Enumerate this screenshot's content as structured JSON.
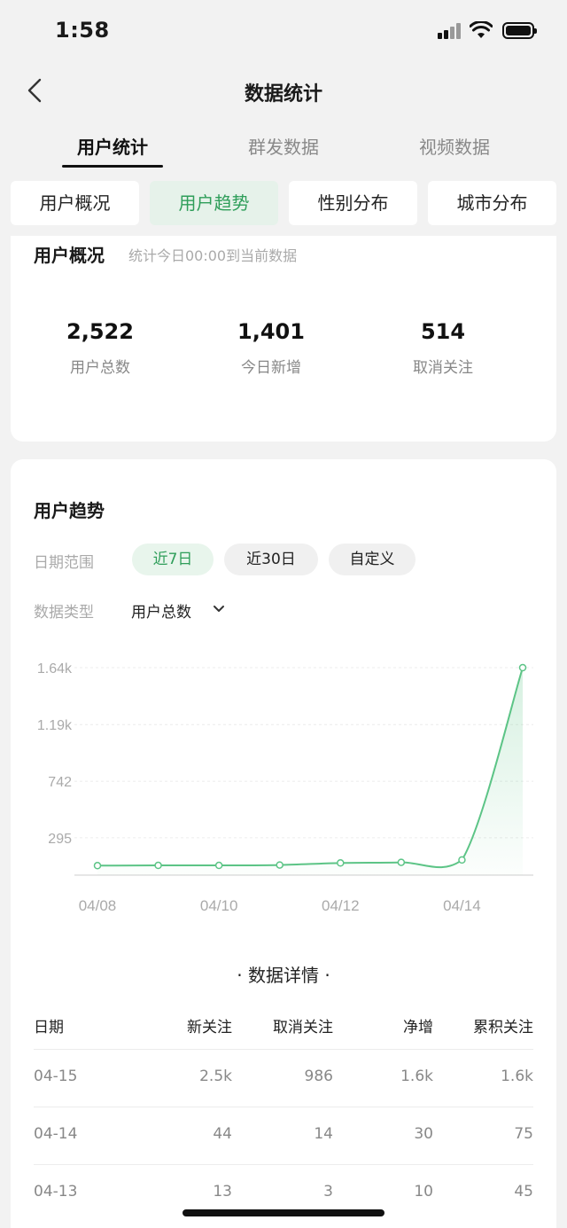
{
  "status_bar": {
    "time": "1:58"
  },
  "nav": {
    "title": "数据统计"
  },
  "tabs": [
    "用户统计",
    "群发数据",
    "视频数据"
  ],
  "subtabs": [
    "用户概况",
    "用户趋势",
    "性别分布",
    "城市分布"
  ],
  "overview": {
    "title": "用户概况",
    "subtitle": "统计今日00:00到当前数据",
    "stats": [
      {
        "value": "2,522",
        "label": "用户总数"
      },
      {
        "value": "1,401",
        "label": "今日新增"
      },
      {
        "value": "514",
        "label": "取消关注"
      }
    ]
  },
  "trend": {
    "title": "用户趋势",
    "date_range_label": "日期范围",
    "date_options": [
      "近7日",
      "近30日",
      "自定义"
    ],
    "type_label": "数据类型",
    "type_value": "用户总数"
  },
  "chart_data": {
    "type": "area",
    "x": [
      "04/08",
      "04/09",
      "04/10",
      "04/11",
      "04/12",
      "04/13",
      "04/14",
      "04/15"
    ],
    "x_tick_labels": [
      "04/08",
      "04/10",
      "04/12",
      "04/14"
    ],
    "values": [
      75,
      77,
      77,
      80,
      96,
      101,
      120,
      1640
    ],
    "y_tick_labels": [
      "1.64k",
      "1.19k",
      "742",
      "295"
    ],
    "y_ticks": [
      1640,
      1190,
      742,
      295
    ],
    "ylim": [
      0,
      1640
    ],
    "grid": true,
    "color": "#5cc486"
  },
  "details": {
    "title": "· 数据详情 ·",
    "columns": [
      "日期",
      "新关注",
      "取消关注",
      "净增",
      "累积关注"
    ],
    "rows": [
      [
        "04-15",
        "2.5k",
        "986",
        "1.6k",
        "1.6k"
      ],
      [
        "04-14",
        "44",
        "14",
        "30",
        "75"
      ],
      [
        "04-13",
        "13",
        "3",
        "10",
        "45"
      ]
    ]
  }
}
